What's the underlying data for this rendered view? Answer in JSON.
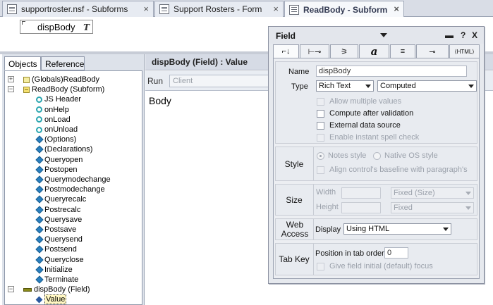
{
  "tabs": [
    {
      "label": "supportroster.nsf - Subforms",
      "close": "×"
    },
    {
      "label": "Support Rosters - Form",
      "close": "×"
    },
    {
      "label": "ReadBody - Subform",
      "close": "×"
    }
  ],
  "design": {
    "field_name": "dispBody",
    "field_type_glyph": "T"
  },
  "left_panel": {
    "tabs": [
      "Objects",
      "Reference"
    ],
    "tree": [
      {
        "label": "(Globals)ReadBody",
        "icon": "globals-icon",
        "toggle": "+"
      },
      {
        "label": "ReadBody (Subform)",
        "icon": "subform-icon",
        "toggle": "−"
      },
      {
        "label": "JS Header",
        "icon": "event-icon"
      },
      {
        "label": "onHelp",
        "icon": "event-icon"
      },
      {
        "label": "onLoad",
        "icon": "event-icon"
      },
      {
        "label": "onUnload",
        "icon": "event-icon"
      },
      {
        "label": "(Options)",
        "icon": "script-icon"
      },
      {
        "label": "(Declarations)",
        "icon": "script-icon"
      },
      {
        "label": "Queryopen",
        "icon": "script-icon"
      },
      {
        "label": "Postopen",
        "icon": "script-icon"
      },
      {
        "label": "Querymodechange",
        "icon": "script-icon"
      },
      {
        "label": "Postmodechange",
        "icon": "script-icon"
      },
      {
        "label": "Queryrecalc",
        "icon": "script-icon"
      },
      {
        "label": "Postrecalc",
        "icon": "script-icon"
      },
      {
        "label": "Querysave",
        "icon": "script-icon"
      },
      {
        "label": "Postsave",
        "icon": "script-icon"
      },
      {
        "label": "Querysend",
        "icon": "script-icon"
      },
      {
        "label": "Postsend",
        "icon": "script-icon"
      },
      {
        "label": "Queryclose",
        "icon": "script-icon"
      },
      {
        "label": "Initialize",
        "icon": "script-icon"
      },
      {
        "label": "Terminate",
        "icon": "script-icon"
      },
      {
        "label": "dispBody (Field)",
        "icon": "field-icon",
        "toggle": "−"
      },
      {
        "label": "Value",
        "icon": "value-icon"
      }
    ]
  },
  "editor": {
    "title": "dispBody (Field) : Value",
    "run_label": "Run",
    "run_value": "Client",
    "code": "Body"
  },
  "props": {
    "title": "Field",
    "controls": {
      "minimize": "▬",
      "help": "?",
      "close": "X"
    },
    "tab_glyphs": [
      "⌐↓",
      "⊢⊸",
      "⚞",
      "a",
      "≡",
      "⊸",
      "⟨HTML⟩"
    ],
    "name_label": "Name",
    "name_value": "dispBody",
    "type_label": "Type",
    "type_value": "Rich Text",
    "type_mode": "Computed",
    "allow_multiple": "Allow multiple values",
    "compute_after": "Compute after validation",
    "external_source": "External data source",
    "spell_check": "Enable instant spell check",
    "style_label": "Style",
    "notes_style": "Notes style",
    "native_style": "Native OS style",
    "align_baseline": "Align control's baseline with paragraph's",
    "size_label": "Size",
    "width_label": "Width",
    "height_label": "Height",
    "width_mode": "Fixed (Size)",
    "height_mode": "Fixed",
    "web_label": "Web Access",
    "display_label": "Display",
    "display_value": "Using HTML",
    "tabkey_label": "Tab Key",
    "tab_order_label": "Position in tab order",
    "tab_order_value": "0",
    "initial_focus": "Give field initial (default) focus"
  }
}
